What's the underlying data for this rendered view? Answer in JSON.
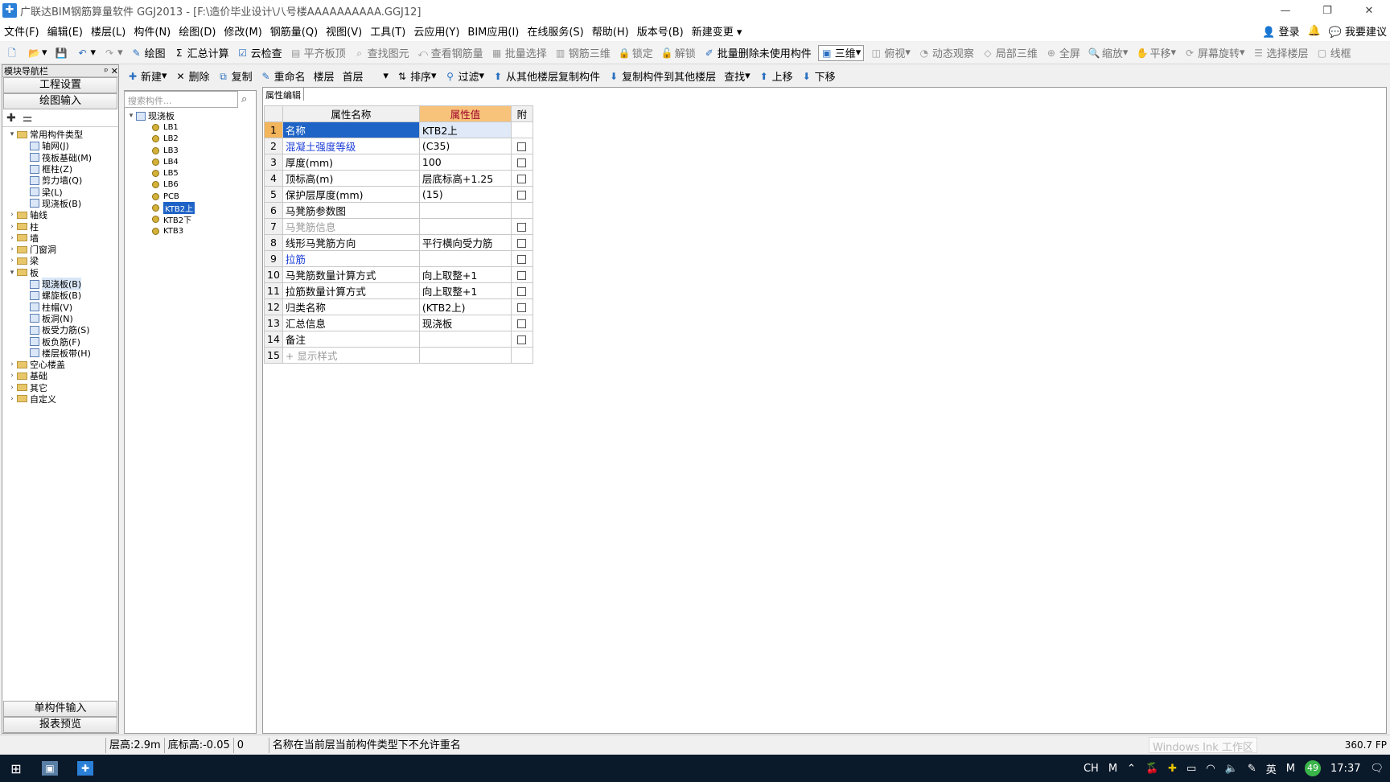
{
  "window": {
    "title": "广联达BIM钢筋算量软件 GGJ2013 - [F:\\造价毕业设计\\八号楼AAAAAAAAAA.GGJ12]",
    "min": "—",
    "max": "❐",
    "close": "✕"
  },
  "menu": [
    "文件(F)",
    "编辑(E)",
    "楼层(L)",
    "构件(N)",
    "绘图(D)",
    "修改(M)",
    "钢筋量(Q)",
    "视图(V)",
    "工具(T)",
    "云应用(Y)",
    "BIM应用(I)",
    "在线服务(S)",
    "帮助(H)",
    "版本号(B)",
    "新建变更 ▾"
  ],
  "menu_right": {
    "login": "登录",
    "suggest": "我要建议"
  },
  "toolbar": {
    "draw": "绘图",
    "sum": "汇总计算",
    "cloudcheck": "云检查",
    "leveltop": "平齐板顶",
    "findelem": "查找图元",
    "viewrebar": "查看钢筋量",
    "batchselect": "批量选择",
    "rebar3d": "钢筋三维",
    "lock": "锁定",
    "unlock": "解锁",
    "batchdelete": "批量删除未使用构件",
    "view3d": "三维",
    "topview": "俯视",
    "dynamic": "动态观察",
    "local3d": "局部三维",
    "fullscreen": "全屏",
    "zoom": "缩放",
    "pan": "平移",
    "rotate": "屏幕旋转",
    "selectfloor": "选择楼层",
    "wireframe": "线框"
  },
  "subtoolbar": {
    "new": "新建",
    "delete": "删除",
    "copy": "复制",
    "rename": "重命名",
    "floor_label": "楼层",
    "floor_value": "首层",
    "sort": "排序",
    "filter": "过滤",
    "copyfrom": "从其他楼层复制构件",
    "copyto": "复制构件到其他楼层",
    "find": "查找",
    "up": "上移",
    "down": "下移"
  },
  "sidebar": {
    "header": "模块导航栏",
    "pin": "ᵖ",
    "close": "✕",
    "btn1": "工程设置",
    "btn2": "绘图输入",
    "btn3": "单构件输入",
    "btn4": "报表预览",
    "tree": [
      {
        "t": "▾",
        "label": "常用构件类型",
        "lvl": 0,
        "folder": true
      },
      {
        "label": "轴网(J)",
        "lvl": 2
      },
      {
        "label": "筏板基础(M)",
        "lvl": 2
      },
      {
        "label": "框柱(Z)",
        "lvl": 2
      },
      {
        "label": "剪力墙(Q)",
        "lvl": 2
      },
      {
        "label": "梁(L)",
        "lvl": 2
      },
      {
        "label": "现浇板(B)",
        "lvl": 2
      },
      {
        "t": "›",
        "label": "轴线",
        "lvl": 0,
        "folder": true
      },
      {
        "t": "›",
        "label": "柱",
        "lvl": 0,
        "folder": true
      },
      {
        "t": "›",
        "label": "墙",
        "lvl": 0,
        "folder": true
      },
      {
        "t": "›",
        "label": "门窗洞",
        "lvl": 0,
        "folder": true
      },
      {
        "t": "›",
        "label": "梁",
        "lvl": 0,
        "folder": true
      },
      {
        "t": "▾",
        "label": "板",
        "lvl": 0,
        "folder": true
      },
      {
        "label": "现浇板(B)",
        "lvl": 2,
        "sel": true
      },
      {
        "label": "螺旋板(B)",
        "lvl": 2
      },
      {
        "label": "柱帽(V)",
        "lvl": 2
      },
      {
        "label": "板洞(N)",
        "lvl": 2
      },
      {
        "label": "板受力筋(S)",
        "lvl": 2
      },
      {
        "label": "板负筋(F)",
        "lvl": 2
      },
      {
        "label": "楼层板带(H)",
        "lvl": 2
      },
      {
        "t": "›",
        "label": "空心楼盖",
        "lvl": 0,
        "folder": true
      },
      {
        "t": "›",
        "label": "基础",
        "lvl": 0,
        "folder": true
      },
      {
        "t": "›",
        "label": "其它",
        "lvl": 0,
        "folder": true
      },
      {
        "t": "›",
        "label": "自定义",
        "lvl": 0,
        "folder": true
      }
    ]
  },
  "search": {
    "placeholder": "搜索构件..."
  },
  "component_tree": {
    "root": "现浇板",
    "items": [
      "LB1",
      "LB2",
      "LB3",
      "LB4",
      "LB5",
      "LB6",
      "PCB",
      "KTB2上",
      "KTB2下",
      "KTB3"
    ],
    "selected": "KTB2上"
  },
  "prop_tab": "属性编辑",
  "prop_table": {
    "headers": [
      "属性名称",
      "属性值",
      "附"
    ],
    "rows": [
      {
        "n": "1",
        "name": "名称",
        "val": "KTB2上",
        "chk": false,
        "style": "sel"
      },
      {
        "n": "2",
        "name": "混凝土强度等级",
        "val": "(C35)",
        "chk": true,
        "style": "blue"
      },
      {
        "n": "3",
        "name": "厚度(mm)",
        "val": "100",
        "chk": true
      },
      {
        "n": "4",
        "name": "顶标高(m)",
        "val": "层底标高+1.25",
        "chk": true
      },
      {
        "n": "5",
        "name": "保护层厚度(mm)",
        "val": "(15)",
        "chk": true
      },
      {
        "n": "6",
        "name": "马凳筋参数图",
        "val": "",
        "chk": false
      },
      {
        "n": "7",
        "name": "马凳筋信息",
        "val": "",
        "chk": true,
        "style": "gray"
      },
      {
        "n": "8",
        "name": "线形马凳筋方向",
        "val": "平行横向受力筋",
        "chk": true
      },
      {
        "n": "9",
        "name": "拉筋",
        "val": "",
        "chk": true,
        "style": "blue"
      },
      {
        "n": "10",
        "name": "马凳筋数量计算方式",
        "val": "向上取整+1",
        "chk": true
      },
      {
        "n": "11",
        "name": "拉筋数量计算方式",
        "val": "向上取整+1",
        "chk": true
      },
      {
        "n": "12",
        "name": "归类名称",
        "val": "(KTB2上)",
        "chk": true
      },
      {
        "n": "13",
        "name": "汇总信息",
        "val": "现浇板",
        "chk": true
      },
      {
        "n": "14",
        "name": "备注",
        "val": "",
        "chk": true
      },
      {
        "n": "15",
        "name": "+ 显示样式",
        "val": "",
        "chk": false,
        "style": "gray"
      }
    ]
  },
  "status": {
    "floor_height": "层高:2.9m",
    "bottom_elev": "底标高:-0.05",
    "zero": "0",
    "msg": "名称在当前层当前构件类型下不允许重名",
    "ink": "Windows Ink 工作区",
    "fps": "360.7 FP"
  },
  "taskbar": {
    "ime1": "CH",
    "ime2": "M",
    "lang": "英",
    "ime3": "M",
    "badge": "49",
    "time": "17:37"
  }
}
